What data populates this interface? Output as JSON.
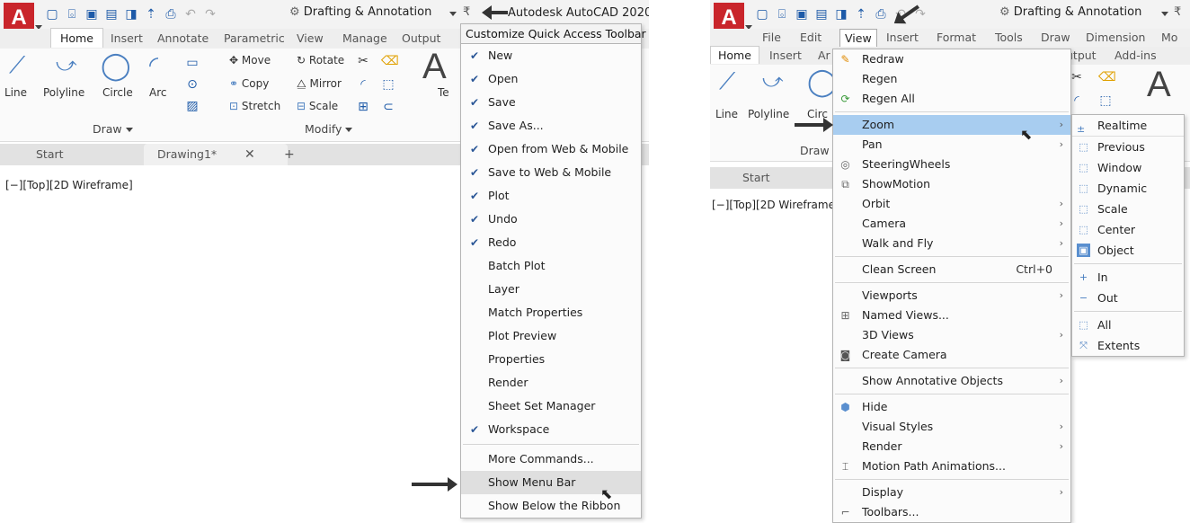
{
  "left": {
    "qat": {
      "workspace": "Drafting & Annotation",
      "app_title": "Autodesk AutoCAD 2020"
    },
    "ribbon_tabs": [
      "Home",
      "Insert",
      "Annotate",
      "Parametric",
      "View",
      "Manage",
      "Output"
    ],
    "tools": {
      "line": "Line",
      "polyline": "Polyline",
      "circle": "Circle",
      "arc": "Arc",
      "move": "Move",
      "rotate": "Rotate",
      "copy": "Copy",
      "mirror": "Mirror",
      "stretch": "Stretch",
      "scale": "Scale",
      "text_cut": "Te"
    },
    "panels": {
      "draw": "Draw",
      "modify": "Modify"
    },
    "file_tabs": {
      "start": "Start",
      "drawing": "Drawing1*",
      "close": "✕",
      "add": "+"
    },
    "viewport_label": "[−][Top][2D Wireframe]",
    "menu": {
      "header": "Customize Quick Access Toolbar",
      "checked_items": [
        "New",
        "Open",
        "Save",
        "Save As...",
        "Open from Web & Mobile",
        "Save to Web & Mobile",
        "Plot",
        "Undo",
        "Redo"
      ],
      "items": [
        "Batch Plot",
        "Layer",
        "Match Properties",
        "Plot Preview",
        "Properties",
        "Render",
        "Sheet Set Manager"
      ],
      "workspace": "Workspace",
      "more": "More Commands...",
      "show_menu_bar": "Show Menu Bar",
      "show_below": "Show Below the Ribbon"
    }
  },
  "right": {
    "qat": {
      "workspace": "Drafting & Annotation"
    },
    "menu_bar": [
      "File",
      "Edit",
      "View",
      "Insert",
      "Format",
      "Tools",
      "Draw",
      "Dimension",
      "Mo"
    ],
    "ribbon_tabs": [
      "Home",
      "Insert",
      "Ar"
    ],
    "ribbon_tabs_right": [
      "utput",
      "Add-ins"
    ],
    "tools": {
      "line": "Line",
      "polyline": "Polyline",
      "circle_cut": "Circ"
    },
    "panels": {
      "draw": "Draw"
    },
    "file_tabs": {
      "start": "Start"
    },
    "viewport_label": "[−][Top][2D Wireframe",
    "view_menu": {
      "g1": [
        "Redraw",
        "Regen",
        "Regen All"
      ],
      "g2": [
        "Zoom",
        "Pan",
        "SteeringWheels",
        "ShowMotion",
        "Orbit",
        "Camera",
        "Walk and Fly"
      ],
      "clean_screen": "Clean Screen",
      "clean_shortcut": "Ctrl+0",
      "g3": [
        "Viewports",
        "Named Views...",
        "3D Views",
        "Create Camera"
      ],
      "g4": [
        "Show Annotative Objects"
      ],
      "g5": [
        "Hide",
        "Visual Styles",
        "Render",
        "Motion Path Animations..."
      ],
      "g6": [
        "Display",
        "Toolbars..."
      ]
    },
    "zoom_menu": {
      "header": "Realtime",
      "g1": [
        "Previous",
        "Window",
        "Dynamic",
        "Scale",
        "Center",
        "Object"
      ],
      "g2": [
        "In",
        "Out"
      ],
      "g3": [
        "All",
        "Extents"
      ]
    }
  },
  "colors": {
    "accent": "#c9252b",
    "highlight": "#a8cdf0",
    "menu_hover": "#dfdfdf"
  }
}
